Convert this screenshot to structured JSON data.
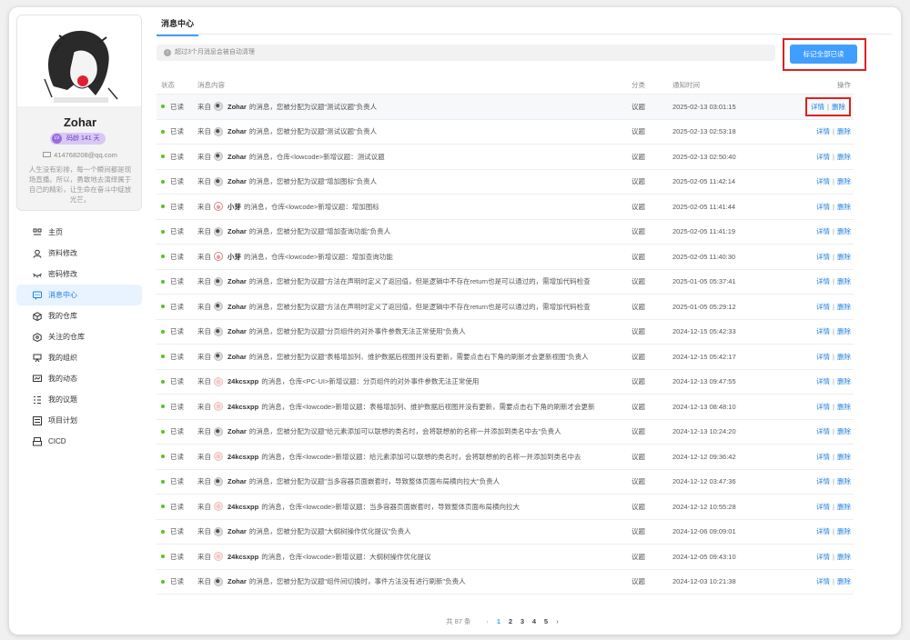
{
  "profile": {
    "name": "Zohar",
    "level_label": "码龄 141 天",
    "level_badge": "LV",
    "email": "414768208@qq.com",
    "bio": "人生没有彩排，每一个瞬间都是现场直播。所以，勇敢地去演绎属于自己的精彩，让生命在奋斗中绽放光芒。"
  },
  "nav": [
    {
      "label": "主页",
      "icon": "home-icon"
    },
    {
      "label": "资料修改",
      "icon": "user-icon"
    },
    {
      "label": "密码修改",
      "icon": "eye-icon"
    },
    {
      "label": "消息中心",
      "icon": "message-icon",
      "active": true
    },
    {
      "label": "我的仓库",
      "icon": "repo-icon"
    },
    {
      "label": "关注的仓库",
      "icon": "star-repo-icon"
    },
    {
      "label": "我的组织",
      "icon": "org-icon"
    },
    {
      "label": "我的动态",
      "icon": "activity-icon"
    },
    {
      "label": "我的议题",
      "icon": "issue-icon"
    },
    {
      "label": "项目计划",
      "icon": "plan-icon"
    },
    {
      "label": "CICD",
      "icon": "cicd-icon"
    }
  ],
  "main": {
    "tab_title": "消息中心",
    "notice": "超过3个月消息会被自动清理",
    "mark_all_label": "标记全部已读",
    "columns": {
      "status": "状态",
      "content": "消息内容",
      "type": "分类",
      "time": "通知时间",
      "ops": "操作"
    },
    "ops": {
      "detail": "详情",
      "sep": "|",
      "delete": "删除"
    },
    "from_label": "来自",
    "rows": [
      {
        "status": "已读",
        "avatar": "zohar",
        "sender": "Zohar",
        "text": "的消息，您被分配为议题\"测试议题\"负责人",
        "type": "议题",
        "time": "2025-02-13 03:01:15"
      },
      {
        "status": "已读",
        "avatar": "zohar",
        "sender": "Zohar",
        "text": "的消息，您被分配为议题\"测试议题\"负责人",
        "type": "议题",
        "time": "2025-02-13 02:53:18"
      },
      {
        "status": "已读",
        "avatar": "zohar",
        "sender": "Zohar",
        "text": "的消息，仓库<lowcode>新增议题：测试议题",
        "type": "议题",
        "time": "2025-02-13 02:50:40"
      },
      {
        "status": "已读",
        "avatar": "zohar",
        "sender": "Zohar",
        "text": "的消息，您被分配为议题\"增加图标\"负责人",
        "type": "议题",
        "time": "2025-02-05 11:42:14"
      },
      {
        "status": "已读",
        "avatar": "xiaoya",
        "sender": "小芽",
        "text": "的消息，仓库<lowcode>新增议题：增加图标",
        "type": "议题",
        "time": "2025-02-05 11:41:44"
      },
      {
        "status": "已读",
        "avatar": "zohar",
        "sender": "Zohar",
        "text": "的消息，您被分配为议题\"增加查询功能\"负责人",
        "type": "议题",
        "time": "2025-02-05 11:41:19"
      },
      {
        "status": "已读",
        "avatar": "xiaoya",
        "sender": "小芽",
        "text": "的消息，仓库<lowcode>新增议题：增加查询功能",
        "type": "议题",
        "time": "2025-02-05 11:40:30"
      },
      {
        "status": "已读",
        "avatar": "zohar",
        "sender": "Zohar",
        "text": "的消息，您被分配为议题\"方法在声明时定义了返回值，但是逻辑中不存在return也是可以通过的，需增加代码检查",
        "type": "议题",
        "time": "2025-01-05 05:37:41"
      },
      {
        "status": "已读",
        "avatar": "zohar",
        "sender": "Zohar",
        "text": "的消息，您被分配为议题\"方法在声明时定义了返回值，但是逻辑中不存在return也是可以通过的，需增加代码检查",
        "type": "议题",
        "time": "2025-01-05 05:29:12"
      },
      {
        "status": "已读",
        "avatar": "zohar",
        "sender": "Zohar",
        "text": "的消息，您被分配为议题\"分页组件的对外事件参数无法正常使用\"负责人",
        "type": "议题",
        "time": "2024-12-15 05:42:33"
      },
      {
        "status": "已读",
        "avatar": "zohar",
        "sender": "Zohar",
        "text": "的消息，您被分配为议题\"表格增加列、维护数据后视图并没有更新，需要点击右下角的刷新才会更新视图\"负责人",
        "type": "议题",
        "time": "2024-12-15 05:42:17"
      },
      {
        "status": "已读",
        "avatar": "kcs",
        "sender": "24kcsxpp",
        "text": "的消息，仓库<PC-UI>新增议题：分页组件的对外事件参数无法正常使用",
        "type": "议题",
        "time": "2024-12-13 09:47:55"
      },
      {
        "status": "已读",
        "avatar": "kcs",
        "sender": "24kcsxpp",
        "text": "的消息，仓库<lowcode>新增议题：表格增加列、维护数据后视图并没有更新，需要点击右下角的刷新才会更新",
        "type": "议题",
        "time": "2024-12-13 08:48:10"
      },
      {
        "status": "已读",
        "avatar": "zohar",
        "sender": "Zohar",
        "text": "的消息，您被分配为议题\"给元素添加可以联想的类名时，会将联想前的名称一并添加到类名中去\"负责人",
        "type": "议题",
        "time": "2024-12-13 10:24:20"
      },
      {
        "status": "已读",
        "avatar": "kcs",
        "sender": "24kcsxpp",
        "text": "的消息，仓库<lowcode>新增议题：给元素添加可以联想的类名时，会将联想前的名称一并添加到类名中去",
        "type": "议题",
        "time": "2024-12-12 09:36:42"
      },
      {
        "status": "已读",
        "avatar": "zohar",
        "sender": "Zohar",
        "text": "的消息，您被分配为议题\"当多容器页面嵌套时，导致整体页面布局横向拉大\"负责人",
        "type": "议题",
        "time": "2024-12-12 03:47:36"
      },
      {
        "status": "已读",
        "avatar": "kcs",
        "sender": "24kcsxpp",
        "text": "的消息，仓库<lowcode>新增议题：当多容器页面嵌套时，导致整体页面布局横向拉大",
        "type": "议题",
        "time": "2024-12-12 10:55:28"
      },
      {
        "status": "已读",
        "avatar": "zohar",
        "sender": "Zohar",
        "text": "的消息，您被分配为议题\"大纲树操作优化提议\"负责人",
        "type": "议题",
        "time": "2024-12-06 09:09:01"
      },
      {
        "status": "已读",
        "avatar": "kcs",
        "sender": "24kcsxpp",
        "text": "的消息，仓库<lowcode>新增议题：大纲树操作优化提议",
        "type": "议题",
        "time": "2024-12-05 09:43:10"
      },
      {
        "status": "已读",
        "avatar": "zohar",
        "sender": "Zohar",
        "text": "的消息，您被分配为议题\"组件间切换时，事件方法没有进行刷新\"负责人",
        "type": "议题",
        "time": "2024-12-03 10:21:38"
      }
    ]
  },
  "pagination": {
    "total": "共 87 条",
    "pages": [
      "1",
      "2",
      "3",
      "4",
      "5"
    ],
    "current": "1",
    "prev": "‹",
    "next": "›"
  },
  "colors": {
    "accent": "#409eff",
    "status_dot": "#52c41a",
    "highlight_box": "#e02020"
  }
}
